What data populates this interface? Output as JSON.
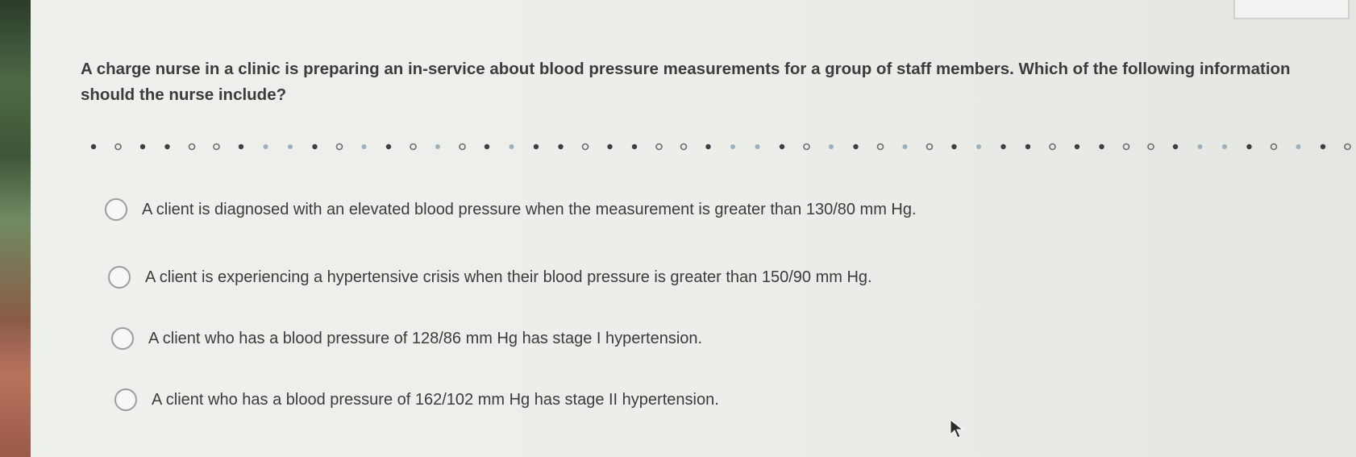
{
  "question": {
    "text": "A charge nurse in a clinic is preparing an in-service about blood pressure measurements for a group of staff members. Which of the following information should the nurse include?"
  },
  "options": [
    {
      "label": "A client is diagnosed with an elevated blood pressure when the measurement is greater than 130/80 mm Hg.",
      "selected": false
    },
    {
      "label": "A client is experiencing a hypertensive crisis when their blood pressure is greater than 150/90 mm Hg.",
      "selected": false
    },
    {
      "label": "A client who has a blood pressure of 128/86 mm Hg has stage I hypertension.",
      "selected": false
    },
    {
      "label": "A client who has a blood pressure of 162/102 mm Hg has stage II hypertension.",
      "selected": false
    }
  ],
  "colors": {
    "background": "#eceee9",
    "text": "#3c3c3e",
    "divider_dot": "#3e3f44",
    "divider_ring": "#6b6c70",
    "divider_light": "#9bb0bd"
  }
}
